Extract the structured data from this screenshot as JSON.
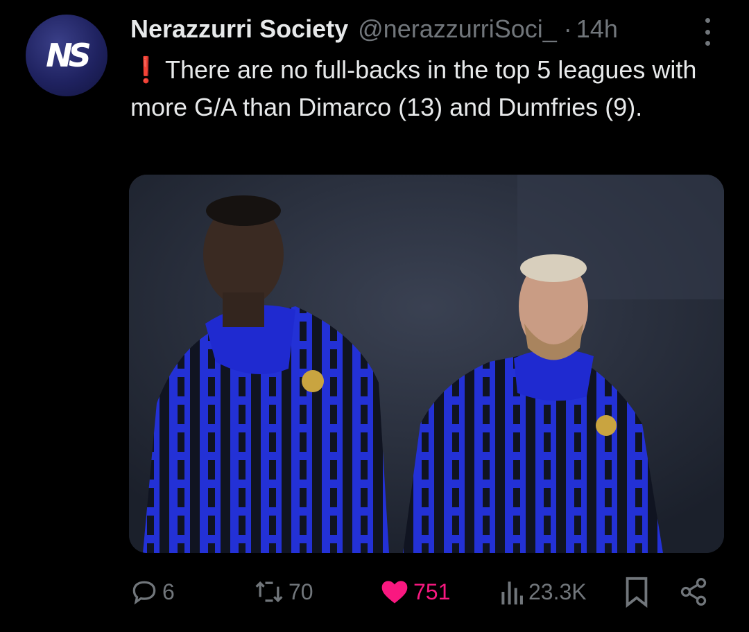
{
  "tweet": {
    "author": {
      "display_name": "Nerazzurri Society",
      "handle": "@nerazzurriSoci_",
      "avatar_logo": "NS"
    },
    "separator": "·",
    "time": "14h",
    "text": {
      "emoji": "❗",
      "body": "There are no full-backs in the top 5 leagues with more G/A than Dimarco (13)  and Dumfries (9)."
    },
    "media": {
      "type": "photo"
    },
    "stats": {
      "replies": "6",
      "retweets": "70",
      "likes": "751",
      "views": "23.3K"
    },
    "icons": {
      "reply": "reply-icon",
      "retweet": "retweet-icon",
      "like": "heart-icon",
      "views": "views-icon",
      "bookmark": "bookmark-icon",
      "share": "share-icon",
      "more": "more-icon"
    },
    "colors": {
      "background": "#000000",
      "text": "#e7e9ea",
      "muted": "#71767b",
      "like": "#f91880",
      "alert": "#f4212e"
    }
  }
}
